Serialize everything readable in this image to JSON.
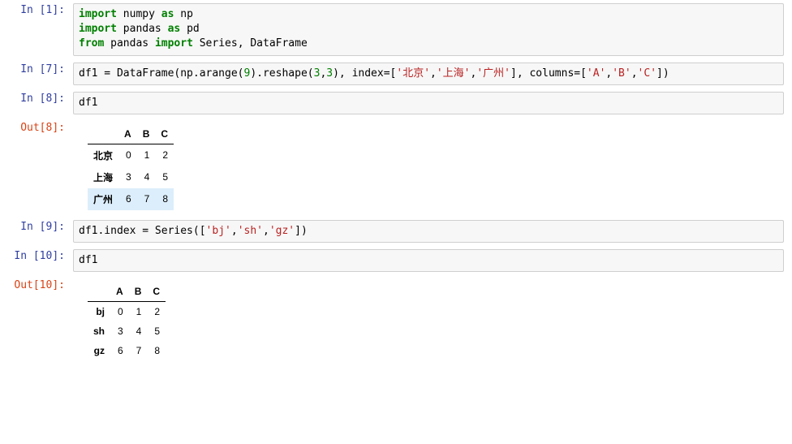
{
  "cells": {
    "c1": {
      "prompt_in": "In [1]:",
      "code_lines": {
        "l1_kw1": "import",
        "l1_nn1": " numpy ",
        "l1_kw2": "as",
        "l1_nn2": " np",
        "l2_kw1": "import",
        "l2_nn1": " pandas ",
        "l2_kw2": "as",
        "l2_nn2": " pd",
        "l3_kw1": "from",
        "l3_nn1": " pandas ",
        "l3_kw2": "import",
        "l3_nn2": " Series, DataFrame"
      }
    },
    "c7": {
      "prompt_in": "In [7]:",
      "code": {
        "p1": "df1 = DataFrame(np.arange(",
        "n1": "9",
        "p2": ").reshape(",
        "n2": "3",
        "p3": ",",
        "n3": "3",
        "p4": "), index=[",
        "s1": "'北京'",
        "p5": ",",
        "s2": "'上海'",
        "p6": ",",
        "s3": "'广州'",
        "p7": "], columns=[",
        "s4": "'A'",
        "p8": ",",
        "s5": "'B'",
        "p9": ",",
        "s6": "'C'",
        "p10": "])"
      }
    },
    "c8": {
      "prompt_in": "In [8]:",
      "code": "df1",
      "prompt_out": "Out[8]:",
      "table": {
        "headers": {
          "h0": "",
          "h1": "A",
          "h2": "B",
          "h3": "C"
        },
        "rows": [
          {
            "idx": "北京",
            "v": [
              "0",
              "1",
              "2"
            ],
            "highlight": false
          },
          {
            "idx": "上海",
            "v": [
              "3",
              "4",
              "5"
            ],
            "highlight": false
          },
          {
            "idx": "广州",
            "v": [
              "6",
              "7",
              "8"
            ],
            "highlight": true
          }
        ]
      }
    },
    "c9": {
      "prompt_in": "In [9]:",
      "code": {
        "p1": "df1.index = Series([",
        "s1": "'bj'",
        "p2": ",",
        "s2": "'sh'",
        "p3": ",",
        "s3": "'gz'",
        "p4": "])"
      }
    },
    "c10": {
      "prompt_in": "In [10]:",
      "code": "df1",
      "prompt_out": "Out[10]:",
      "table": {
        "headers": {
          "h0": "",
          "h1": "A",
          "h2": "B",
          "h3": "C"
        },
        "rows": [
          {
            "idx": "bj",
            "v": [
              "0",
              "1",
              "2"
            ],
            "highlight": false
          },
          {
            "idx": "sh",
            "v": [
              "3",
              "4",
              "5"
            ],
            "highlight": false
          },
          {
            "idx": "gz",
            "v": [
              "6",
              "7",
              "8"
            ],
            "highlight": false
          }
        ]
      }
    }
  }
}
